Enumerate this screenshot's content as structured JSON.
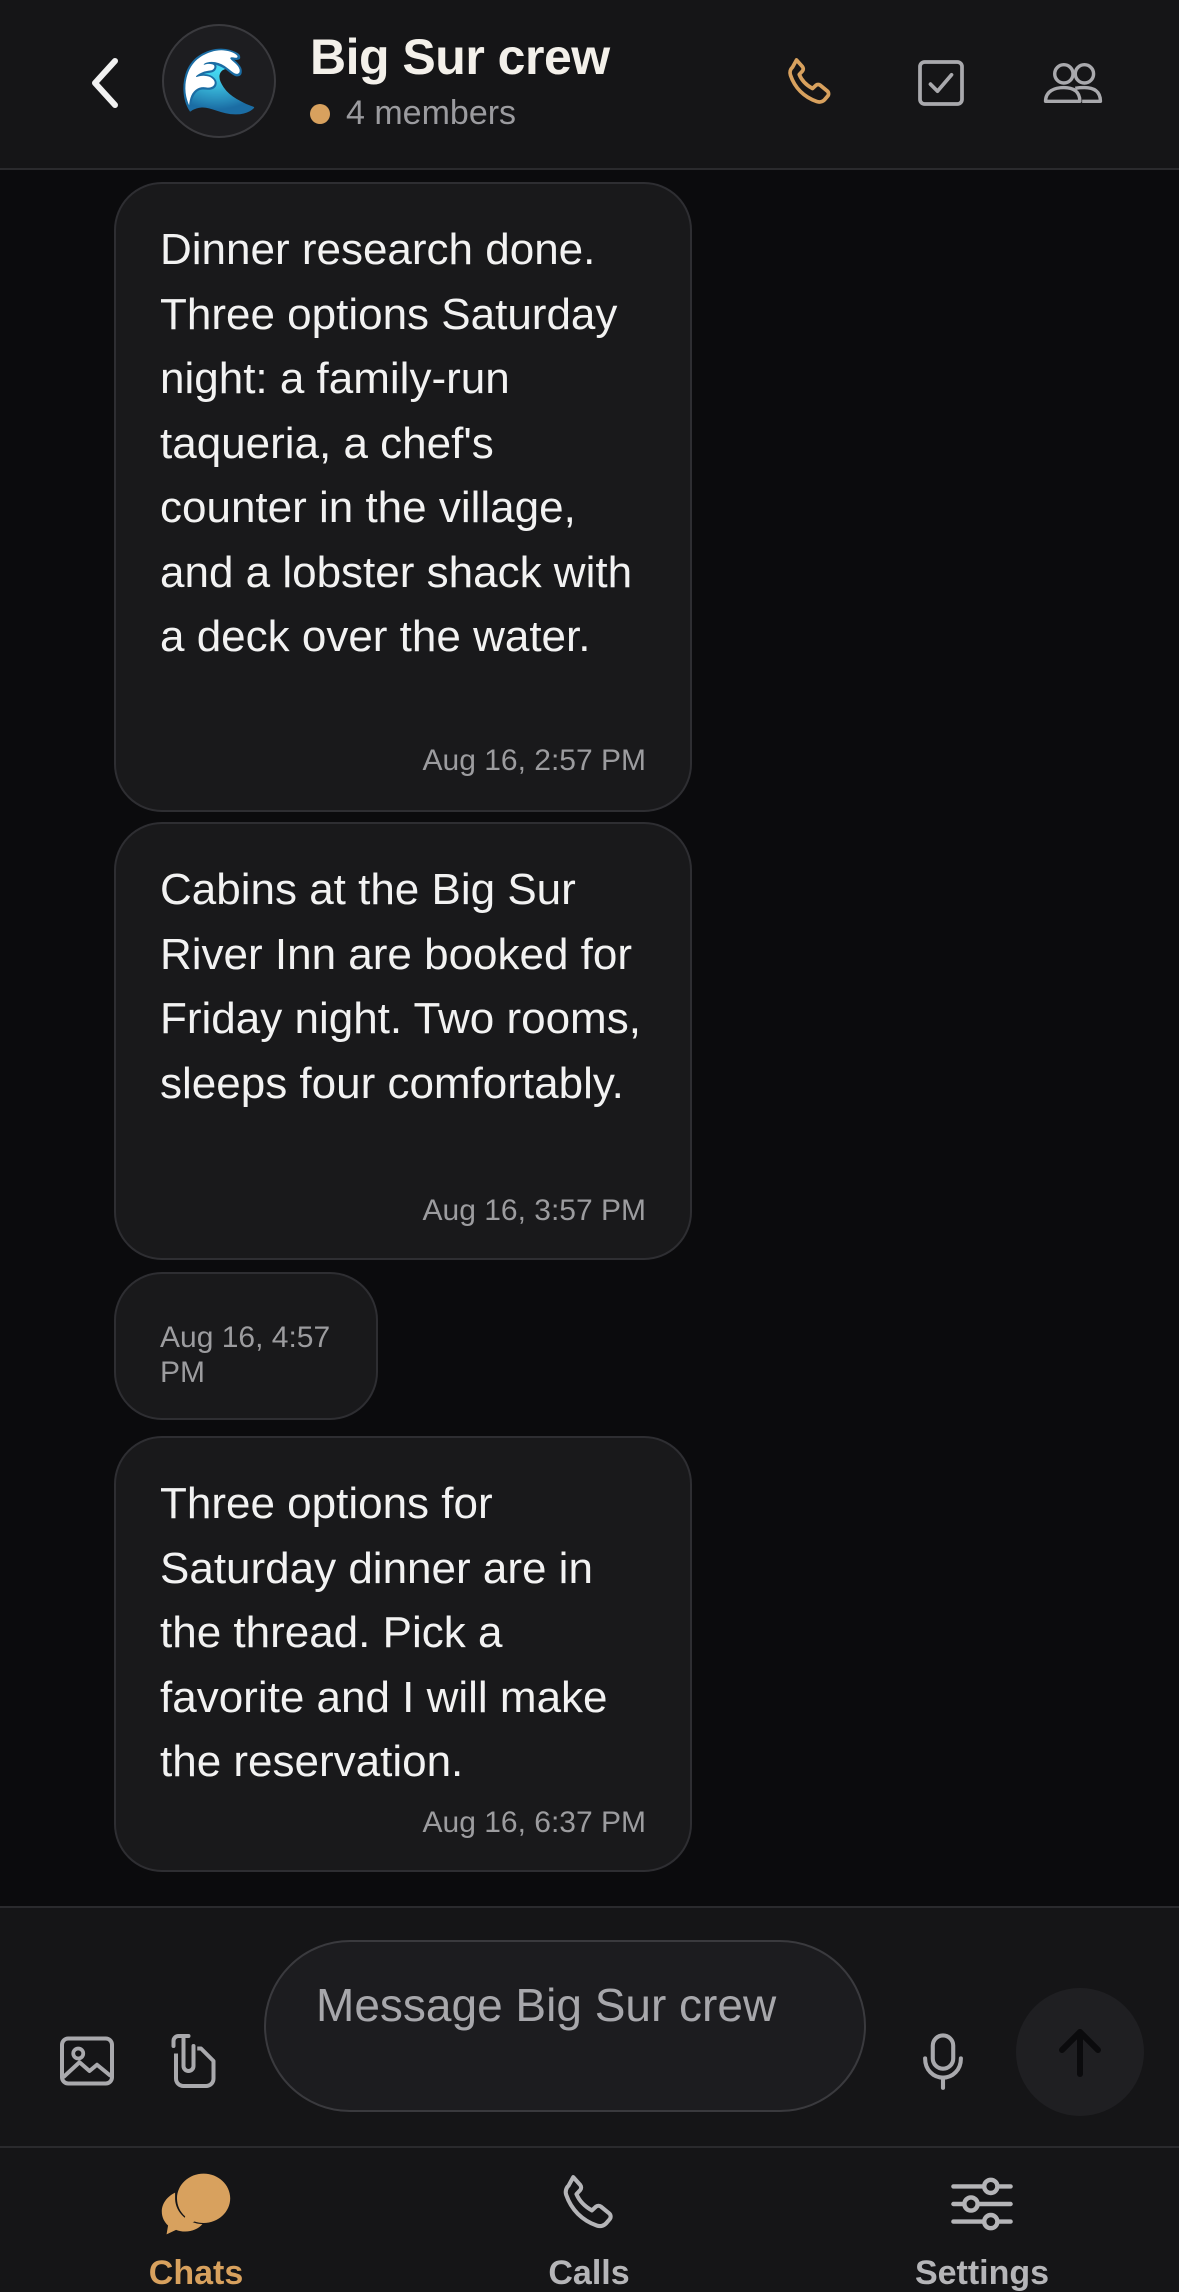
{
  "header": {
    "back_icon": "chevron-left-icon",
    "avatar_emoji": "🌊",
    "title": "Big Sur crew",
    "members": "4 members",
    "status_dot_color": "#d8a15e",
    "actions": [
      "phone-icon",
      "checkbox-icon",
      "group-icon"
    ]
  },
  "messages": [
    {
      "text": "Dinner research done. Three options Saturday night: a family-run taqueria, a chef's counter in the village, and a lobster shack with a deck over the water.",
      "time": "Aug 16, 2:57 PM"
    },
    {
      "text": "Cabins at the Big Sur River Inn are booked for Friday night. Two rooms, sleeps four comfortably.",
      "time": "Aug 16, 3:57 PM"
    },
    {
      "text": "",
      "time": "Aug 16, 4:57 PM"
    },
    {
      "text": "Three options for Saturday dinner are in the thread. Pick a favorite and I will make the reservation.",
      "time": "Aug 16, 6:37 PM"
    }
  ],
  "composer": {
    "placeholder": "Message Big Sur crew",
    "icons": [
      "image-icon",
      "attach-icon",
      "microphone-icon",
      "send-arrow-icon"
    ]
  },
  "tabs": [
    {
      "label": "Chats",
      "icon": "chat-bubble-icon",
      "active": true
    },
    {
      "label": "Calls",
      "icon": "phone-icon",
      "active": false
    },
    {
      "label": "Settings",
      "icon": "sliders-icon",
      "active": false
    }
  ],
  "colors": {
    "accent": "#d8a15e",
    "background": "#0b0b0d",
    "bubble": "#19191b"
  }
}
